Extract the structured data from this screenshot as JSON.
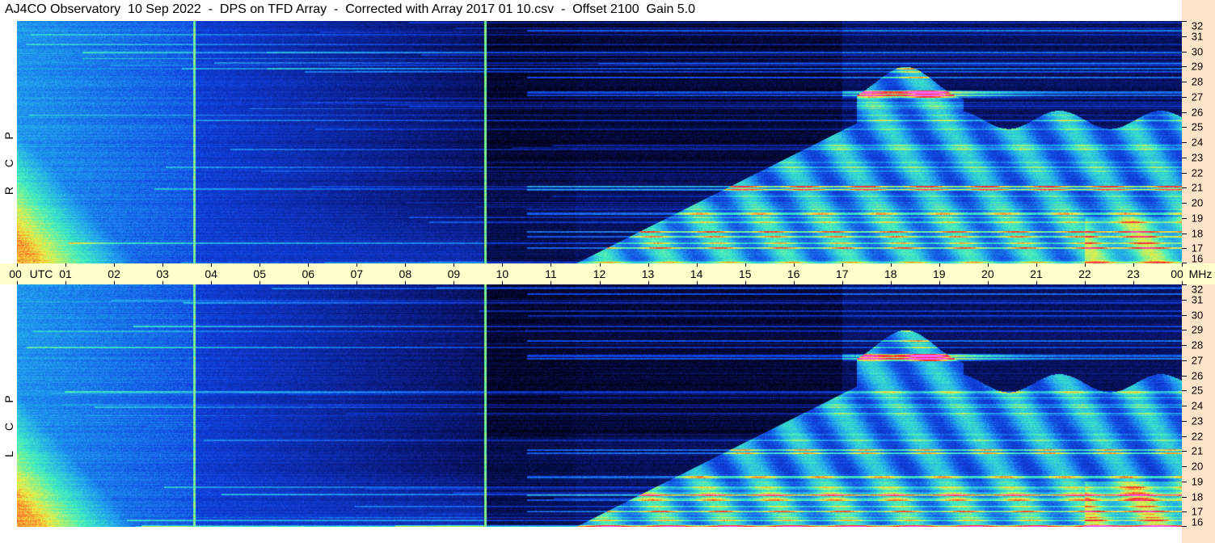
{
  "title": "AJ4CO Observatory  10 Sep 2022  -  DPS on TFD Array  -  Corrected with Array 2017 01 10.csv  -  Offset 2100  Gain 5.0",
  "chart_data": [
    {
      "type": "heatmap",
      "panel": "upper",
      "polarization_label": [
        "R",
        "C",
        "P"
      ],
      "x_axis": {
        "label": "UTC",
        "range_hours": [
          0,
          24
        ],
        "tick_labels": [
          "00",
          "01",
          "02",
          "03",
          "04",
          "05",
          "06",
          "07",
          "08",
          "09",
          "10",
          "11",
          "12",
          "13",
          "14",
          "15",
          "16",
          "17",
          "18",
          "19",
          "20",
          "21",
          "22",
          "23",
          "00"
        ]
      },
      "y_axis": {
        "label": "MHz",
        "range": [
          16,
          32
        ],
        "tick_labels": [
          "16",
          "17",
          "18",
          "19",
          "20",
          "21",
          "22",
          "23",
          "24",
          "25",
          "26",
          "27",
          "28",
          "29",
          "30",
          "31",
          "32"
        ]
      },
      "colormap": [
        "#000010",
        "#0a1a80",
        "#1040e0",
        "#20a0f0",
        "#40f0c0",
        "#f0f040",
        "#ff2020",
        "#ff60ff"
      ],
      "vertical_lines_utc": [
        3.65,
        9.65
      ]
    },
    {
      "type": "heatmap",
      "panel": "lower",
      "polarization_label": [
        "L",
        "C",
        "P"
      ],
      "x_axis": {
        "label": "UTC",
        "range_hours": [
          0,
          24
        ]
      },
      "y_axis": {
        "label": "MHz",
        "range": [
          16,
          32
        ],
        "tick_labels": [
          "16",
          "17",
          "18",
          "19",
          "20",
          "21",
          "22",
          "23",
          "24",
          "25",
          "26",
          "27",
          "28",
          "29",
          "30",
          "31",
          "32"
        ]
      },
      "colormap": [
        "#000010",
        "#0a1a80",
        "#1040e0",
        "#20a0f0",
        "#40f0c0",
        "#f0f040",
        "#ff2020",
        "#ff60ff"
      ],
      "vertical_lines_utc": [
        3.65,
        9.65
      ]
    }
  ],
  "axis": {
    "utc_label": "UTC",
    "mhz_label": "MHz"
  }
}
